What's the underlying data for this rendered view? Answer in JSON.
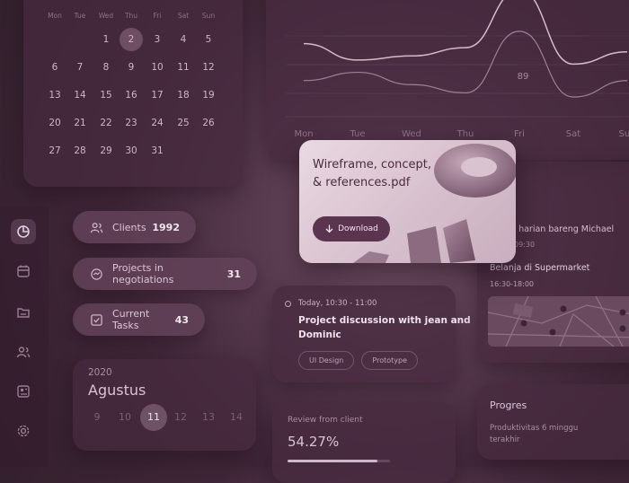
{
  "calendar": {
    "weekdays": [
      "Mon",
      "Tue",
      "Wed",
      "Thu",
      "Fri",
      "Sat",
      "Sun"
    ],
    "weeks": [
      [
        "",
        "",
        "1",
        "2",
        "3",
        "4",
        "5"
      ],
      [
        "6",
        "7",
        "8",
        "9",
        "10",
        "11",
        "12"
      ],
      [
        "13",
        "14",
        "15",
        "16",
        "17",
        "18",
        "19"
      ],
      [
        "20",
        "21",
        "22",
        "23",
        "24",
        "25",
        "26"
      ],
      [
        "27",
        "28",
        "29",
        "30",
        "31",
        "",
        ""
      ]
    ],
    "selected": "2"
  },
  "chart_data": {
    "type": "line",
    "categories": [
      "Mon",
      "Tue",
      "Wed",
      "Thu",
      "Fri",
      "Sat",
      "Sun"
    ],
    "series": [
      {
        "values": [
          70,
          62,
          64,
          68,
          96,
          60,
          66
        ]
      },
      {
        "values": [
          52,
          56,
          50,
          46,
          76,
          44,
          52
        ]
      }
    ],
    "annotations": [
      "89"
    ]
  },
  "stats": [
    {
      "label": "Clients",
      "value": "1992",
      "icon": "users-icon"
    },
    {
      "label": "Projects in negotiations",
      "value": "31",
      "icon": "handshake-icon"
    },
    {
      "label": "Current Tasks",
      "value": "43",
      "icon": "checkbox-icon"
    }
  ],
  "sidebar": {
    "icons": [
      "pie-chart-icon",
      "calendar-icon",
      "folder-icon",
      "users-icon",
      "board-icon",
      "gear-icon"
    ],
    "active": 0
  },
  "file_card": {
    "title_line1": "Wireframe, concept,",
    "title_line2": "& references.pdf",
    "button_label": "Download"
  },
  "month_card": {
    "year": "2020",
    "month": "Agustus",
    "days": [
      "9",
      "10",
      "11",
      "12",
      "13",
      "14"
    ],
    "selected": "11"
  },
  "event_card": {
    "time": "Today, 10:30 - 11:00",
    "title_line1": "Project discussion with jean and",
    "title_line2": "Dominic",
    "tags": [
      "UI Design",
      "Prototype"
    ]
  },
  "review_card": {
    "label": "Review from client",
    "value": "54.27%",
    "progress": 0.88
  },
  "schedule": {
    "item1_title": "ng harian bareng Michael",
    "item1_time": "09:30",
    "item2_title": "Belanja di Supermarket",
    "item2_time": "16:30-18:00"
  },
  "progress_card": {
    "title": "Progres",
    "line1": "Produktivitas 6 minggu",
    "line2": "terakhir"
  },
  "colors": {
    "accent": "#5b3550",
    "card": "#462a3e",
    "text": "#e9dbe4"
  }
}
